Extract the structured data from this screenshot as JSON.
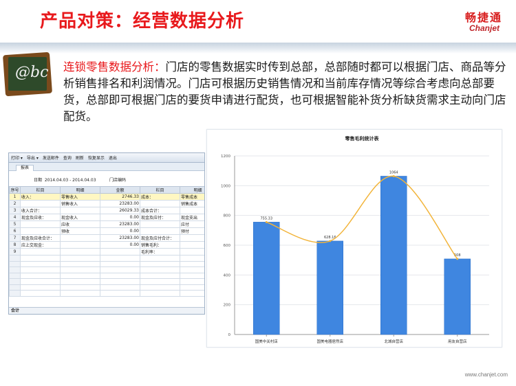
{
  "title": "产品对策：经营数据分析",
  "logo": {
    "cn": "畅捷通",
    "en": "Chanjet"
  },
  "board_text": "@bc",
  "description": {
    "highlight": "连锁零售数据分析：",
    "body": "门店的零售数据实时传到总部，总部随时都可以根据门店、商品等分析销售排名和利润情况。门店可根据历史销售情况和当前库存情况等综合考虑向总部要货，总部即可根据门店的要货申请进行配货，也可根据智能补货分析缺货需求主动向门店配货。"
  },
  "report": {
    "toolbar": [
      "打印 ▾",
      "导出 ▾",
      "发送邮件",
      "查询",
      "刷新",
      "恢复显示",
      "退出"
    ],
    "tab": "报表",
    "date_label": "日期",
    "date_value": "2014.04.03 - 2014.04.03",
    "store_label": "门店编码",
    "columns": [
      "序号",
      "栏目",
      "明细",
      "金额",
      "栏目",
      "明细"
    ],
    "rows": [
      {
        "idx": "1",
        "c1": "收入：",
        "c2": "零售收入",
        "amt": "2746.33",
        "c4": "成本：",
        "c5": "零售成本"
      },
      {
        "idx": "2",
        "c1": "",
        "c2": "销售收入",
        "amt": "23283.00",
        "c4": "",
        "c5": "销售成本"
      },
      {
        "idx": "3",
        "c1": "收入合计：",
        "c2": "",
        "amt": "26029.33",
        "c4": "成本合计：",
        "c5": ""
      },
      {
        "idx": "4",
        "c1": "现金及应收：",
        "c2": "现金收入",
        "amt": "0.00",
        "c4": "现金及应付：",
        "c5": "现金支出"
      },
      {
        "idx": "5",
        "c1": "",
        "c2": "应收",
        "amt": "23283.00",
        "c4": "",
        "c5": "应付"
      },
      {
        "idx": "6",
        "c1": "",
        "c2": "预收",
        "amt": "0.00",
        "c4": "",
        "c5": "预付"
      },
      {
        "idx": "7",
        "c1": "现金及应收合计：",
        "c2": "",
        "amt": "23283.00",
        "c4": "现金及应付合计：",
        "c5": ""
      },
      {
        "idx": "8",
        "c1": "应上交现金：",
        "c2": "",
        "amt": "0.00",
        "c4": "销售毛利：",
        "c5": ""
      },
      {
        "idx": "9",
        "c1": "",
        "c2": "",
        "amt": "",
        "c4": "毛利率：",
        "c5": ""
      }
    ],
    "total_label": "合计"
  },
  "chart_data": {
    "type": "bar",
    "title": "零售毛利统计表",
    "categories": [
      "国美中关村店",
      "国美电器居然店",
      "北城自营店",
      "用友自营店"
    ],
    "values": [
      755.33,
      628.16,
      1064,
      508
    ],
    "data_labels": [
      "755.33",
      "628.16",
      "1064",
      "508"
    ],
    "ylim": [
      0,
      1200
    ],
    "yticks": [
      0,
      200,
      400,
      600,
      800,
      1000,
      1200
    ],
    "grid": true,
    "trend_line": true,
    "colors": {
      "bar": "#3f86e0",
      "bar_edge": "#2a6fc9",
      "trend": "#f2b43a",
      "grid": "#e4e7eb"
    }
  },
  "footer": "www.chanjet.com"
}
